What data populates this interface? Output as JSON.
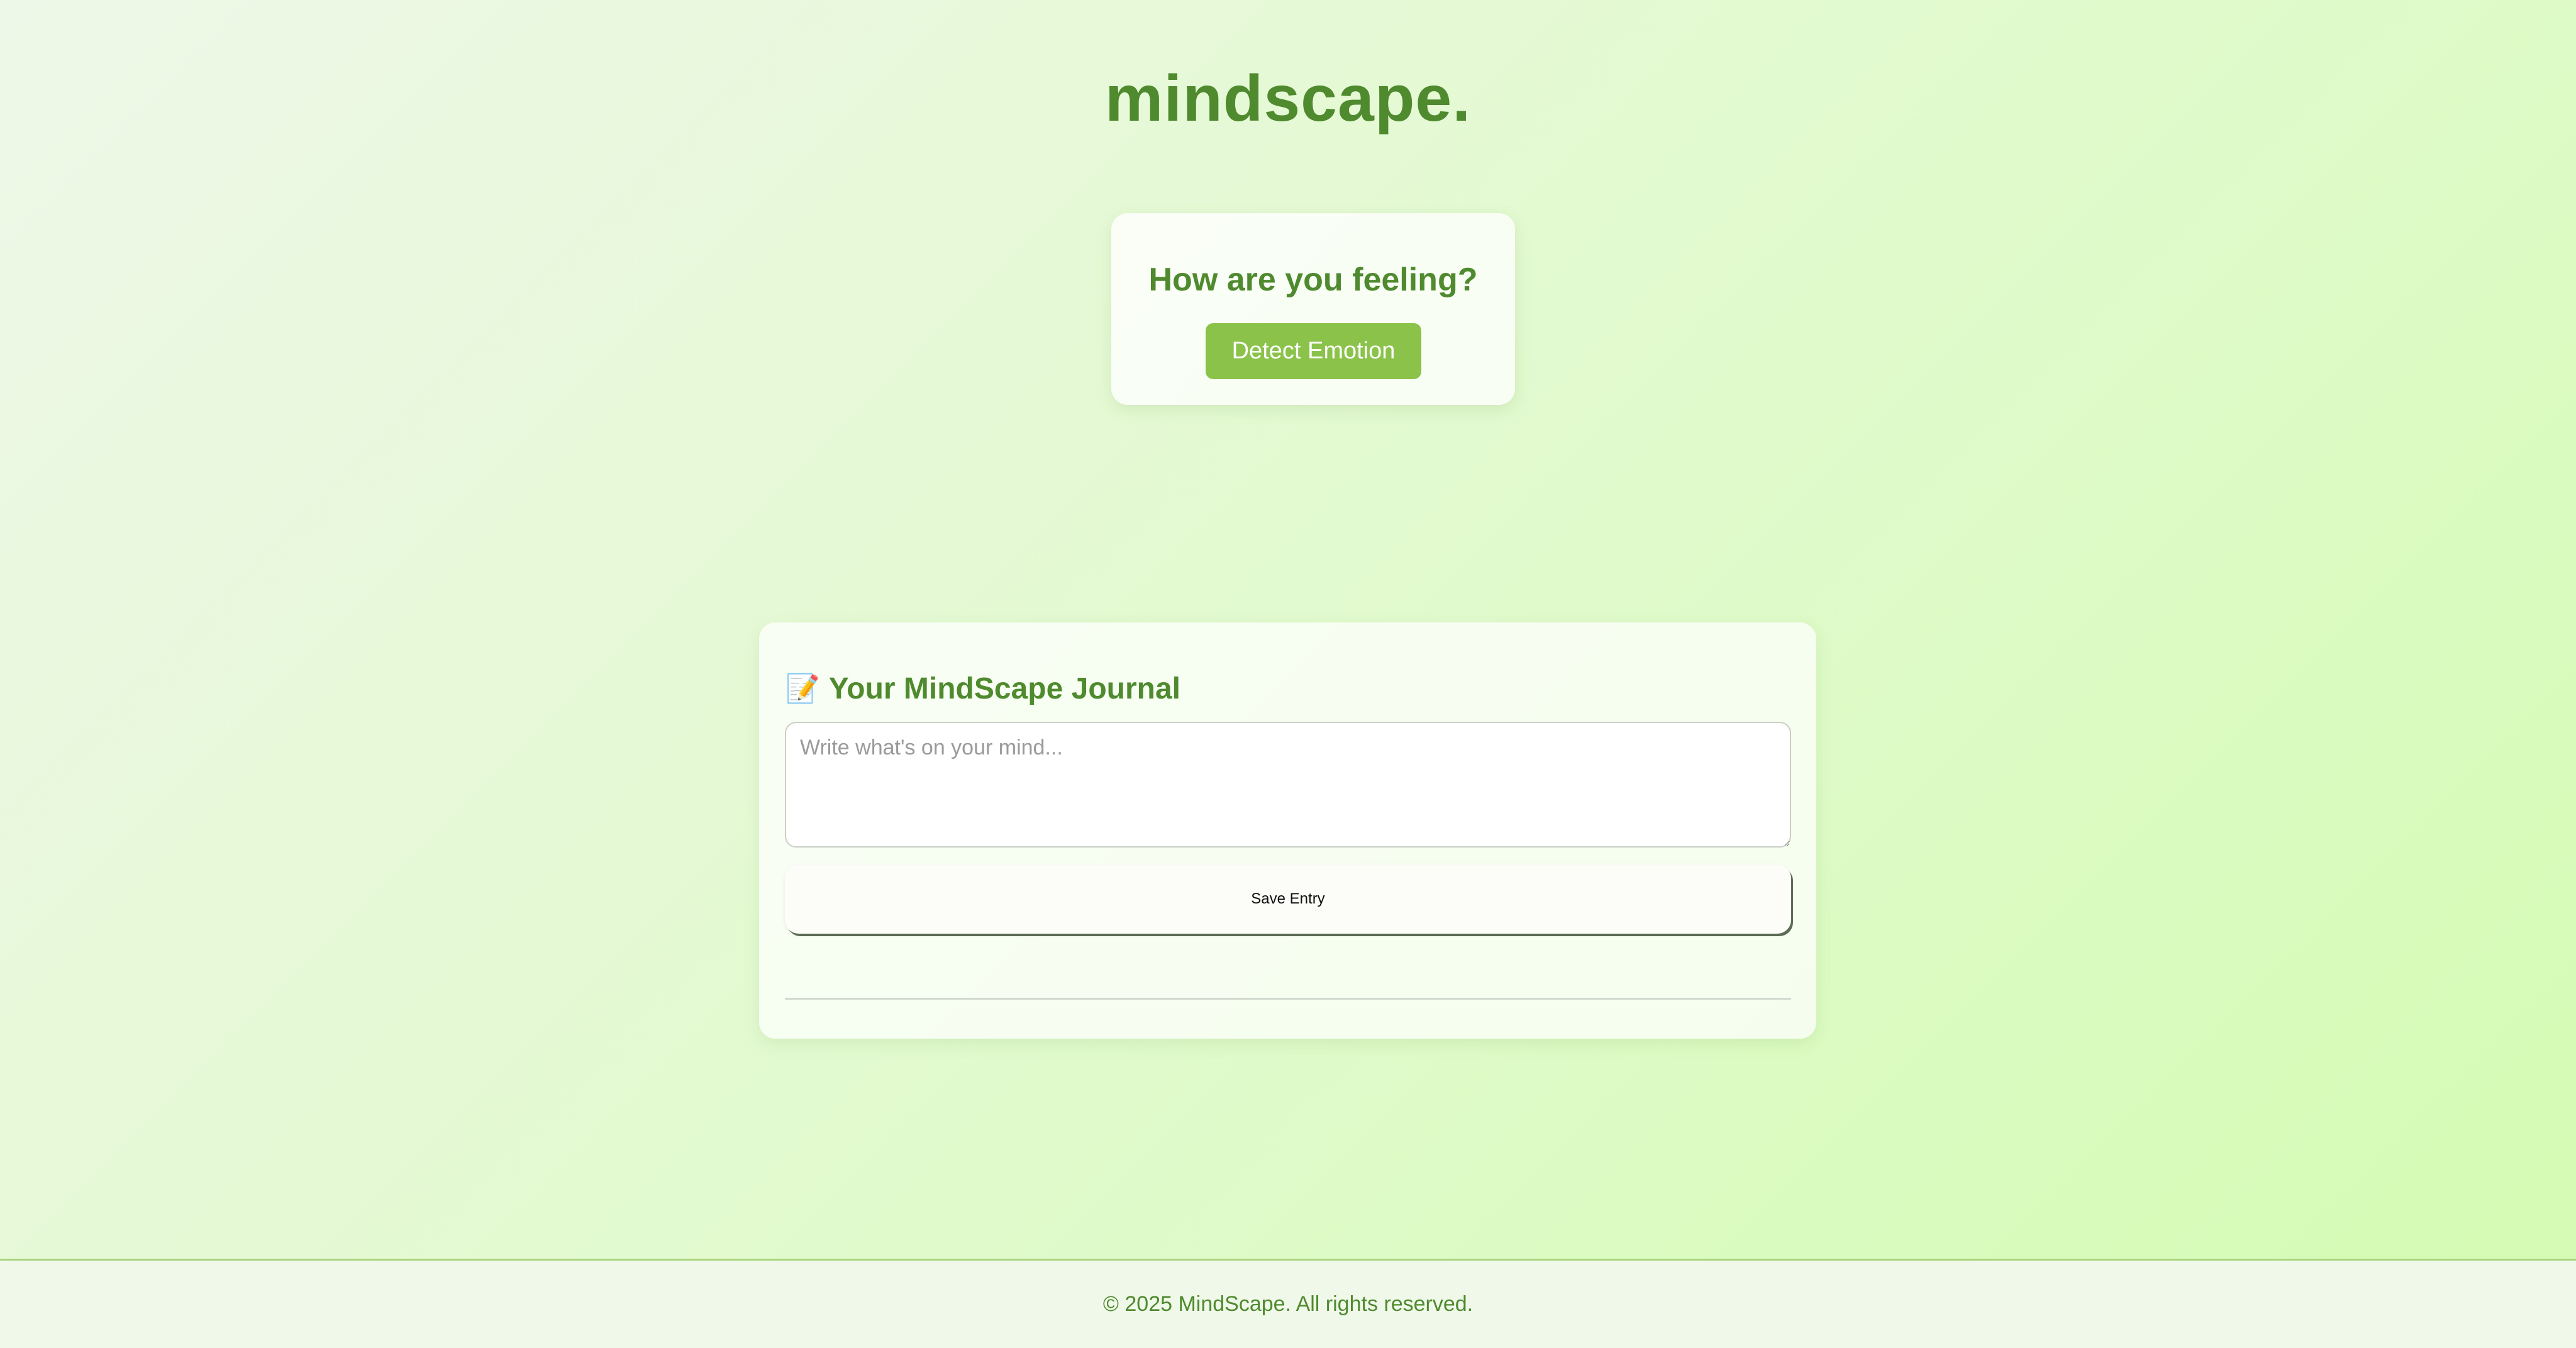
{
  "header": {
    "brand": "mindscape."
  },
  "emotion": {
    "heading": "How are you feeling?",
    "detect_button": "Detect Emotion"
  },
  "journal": {
    "icon": "memo-icon",
    "icon_glyph": "📝",
    "title": "Your MindScape Journal",
    "input_value": "",
    "input_placeholder": "Write what's on your mind...",
    "save_button": "Save Entry"
  },
  "footer": {
    "copyright": "© 2025 MindScape. All rights reserved."
  },
  "colors": {
    "accent": "#8bc34a",
    "brand_text": "#4f8a2e",
    "background_start": "#eef8e8",
    "background_end": "#d4fbb2"
  }
}
